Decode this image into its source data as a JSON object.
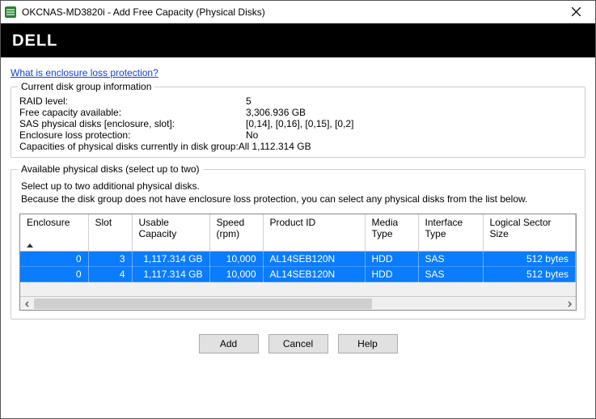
{
  "window": {
    "title": "OKCNAS-MD3820i - Add Free Capacity (Physical Disks)"
  },
  "brand": {
    "text": "DELL"
  },
  "link": {
    "enclosure_loss": "What is enclosure loss protection?"
  },
  "group_info": {
    "legend": "Current disk group information",
    "labels": {
      "raid": "RAID level:",
      "free": "Free capacity available:",
      "sas": "SAS physical disks [enclosure, slot]:",
      "loss": "Enclosure loss protection:"
    },
    "values": {
      "raid": "5",
      "free": "3,306.936 GB",
      "sas": "[0,14], [0,16], [0,15], [0,2]",
      "loss": "No"
    },
    "cap_line_prefix": "Capacities of physical disks currently in disk group:",
    "cap_line_value": "All 1,112.314 GB"
  },
  "group_avail": {
    "legend": "Available physical disks (select up to two)",
    "instr1": "Select up to two additional physical disks.",
    "instr2": "Because the disk group does not have enclosure loss protection, you can select any physical disks from the list below."
  },
  "table": {
    "headers": {
      "enclosure": "Enclosure",
      "slot": "Slot",
      "usable": "Usable Capacity",
      "speed": "Speed (rpm)",
      "product": "Product ID",
      "media": "Media Type",
      "iface": "Interface Type",
      "sector": "Logical Sector Size"
    },
    "rows": [
      {
        "enclosure": "0",
        "slot": "3",
        "usable": "1,117.314 GB",
        "speed": "10,000",
        "product": "AL14SEB120N",
        "media": "HDD",
        "iface": "SAS",
        "sector": "512 bytes"
      },
      {
        "enclosure": "0",
        "slot": "4",
        "usable": "1,117.314 GB",
        "speed": "10,000",
        "product": "AL14SEB120N",
        "media": "HDD",
        "iface": "SAS",
        "sector": "512 bytes"
      }
    ]
  },
  "buttons": {
    "add": "Add",
    "cancel": "Cancel",
    "help": "Help"
  }
}
